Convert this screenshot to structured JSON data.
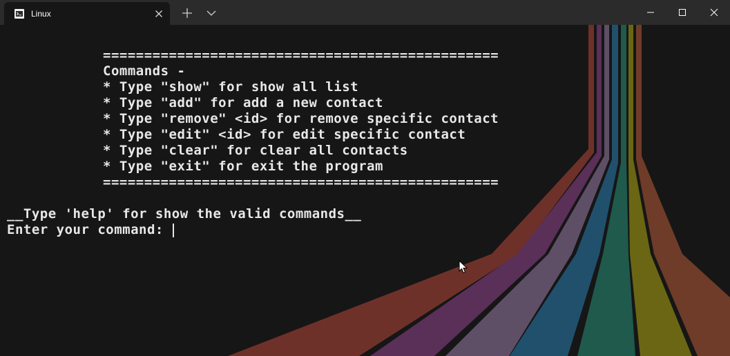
{
  "titlebar": {
    "tab_title": "Linux",
    "tab_icon": "terminal-icon",
    "new_tab_icon": "plus-icon",
    "dropdown_icon": "chevron-down-icon",
    "minimize_icon": "minimize-icon",
    "maximize_icon": "maximize-icon",
    "close_icon": "close-icon"
  },
  "terminal": {
    "divider_top": "================================================",
    "commands_header": "Commands -",
    "commands": [
      "* Type \"show\" for show all list",
      "* Type \"add\" for add a new contact",
      "* Type \"remove\" <id> for remove specific contact",
      "* Type \"edit\" <id> for edit specific contact",
      "* Type \"clear\" for clear all contacts",
      "* Type \"exit\" for exit the program"
    ],
    "divider_bottom": "================================================",
    "help_line": "__Type 'help' for show the valid commands__",
    "prompt": "Enter your command: "
  },
  "colors": {
    "background": "#161616",
    "titlebar": "#2b2b2b",
    "text": "#e8e8e8",
    "stripe_red": "#6e3129",
    "stripe_purple": "#5a2f58",
    "stripe_mauve": "#5f4f66",
    "stripe_blue": "#20506c",
    "stripe_green": "#1f5a4c",
    "stripe_olive": "#6b6614",
    "stripe_orange": "#6e3c28"
  }
}
